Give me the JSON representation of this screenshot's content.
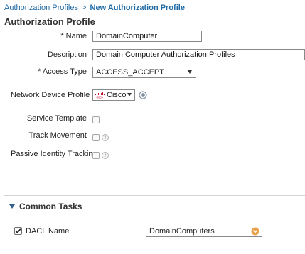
{
  "breadcrumb": {
    "parent": "Authorization Profiles",
    "separator": ">",
    "current": "New Authorization Profile"
  },
  "page_title": "Authorization Profile",
  "form": {
    "name": {
      "label": "* Name",
      "value": "DomainComputer"
    },
    "description": {
      "label": "Description",
      "value": "Domain Computer Authorization Profiles"
    },
    "access_type": {
      "label": "* Access Type",
      "value": "ACCESS_ACCEPT"
    },
    "network_device_profile": {
      "label": "Network Device Profile",
      "value": "Cisco",
      "logo_text": "cisco"
    },
    "service_template": {
      "label": "Service Template",
      "checked": false
    },
    "track_movement": {
      "label": "Track Movement",
      "checked": false
    },
    "passive_identity_tracking": {
      "label": "Passive Identity Tracking",
      "checked": false
    }
  },
  "common_tasks": {
    "title": "Common Tasks",
    "dacl": {
      "label": "DACL Name",
      "checked": true,
      "value": "DomainComputers"
    }
  },
  "colors": {
    "link": "#1f6aa5",
    "dropdown_accent": "#e8a04a",
    "cisco_logo": "#c8102e"
  },
  "icons": {
    "info": "info-icon",
    "add": "add-circle-icon",
    "collapse": "triangle-down-icon",
    "dropdown": "chevron-down-icon"
  }
}
